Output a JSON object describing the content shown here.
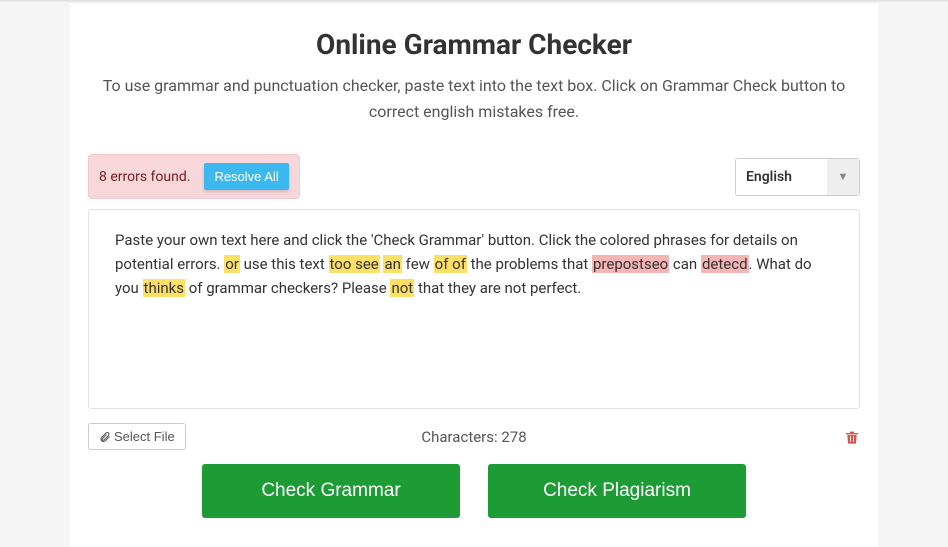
{
  "header": {
    "title": "Online Grammar Checker",
    "subtitle": "To use grammar and punctuation checker, paste text into the text box. Click on Grammar Check button to correct english mistakes free."
  },
  "errors": {
    "found_text": "8 errors found.",
    "resolve_label": "Resolve All"
  },
  "language": {
    "selected": "English"
  },
  "editor": {
    "segments": [
      {
        "text": "Paste your own text here and click the 'Check Grammar' button. Click the colored phrases for details on potential errors. ",
        "type": "plain"
      },
      {
        "text": "or",
        "type": "yellow"
      },
      {
        "text": " use this text ",
        "type": "plain"
      },
      {
        "text": "too see",
        "type": "yellow"
      },
      {
        "text": " ",
        "type": "plain"
      },
      {
        "text": "an",
        "type": "yellow"
      },
      {
        "text": " few ",
        "type": "plain"
      },
      {
        "text": "of of",
        "type": "yellow"
      },
      {
        "text": " the problems that ",
        "type": "plain"
      },
      {
        "text": "prepostseo",
        "type": "red"
      },
      {
        "text": " can ",
        "type": "plain"
      },
      {
        "text": "detecd",
        "type": "red"
      },
      {
        "text": ". What do you ",
        "type": "plain"
      },
      {
        "text": "thinks",
        "type": "yellow"
      },
      {
        "text": " of grammar checkers? Please ",
        "type": "plain"
      },
      {
        "text": "not",
        "type": "yellow"
      },
      {
        "text": " that they are not perfect.",
        "type": "plain"
      }
    ]
  },
  "footer": {
    "select_file_label": "Select File",
    "char_label": "Characters: ",
    "char_count": "278"
  },
  "actions": {
    "check_grammar": "Check Grammar",
    "check_plagiarism": "Check Plagiarism"
  }
}
